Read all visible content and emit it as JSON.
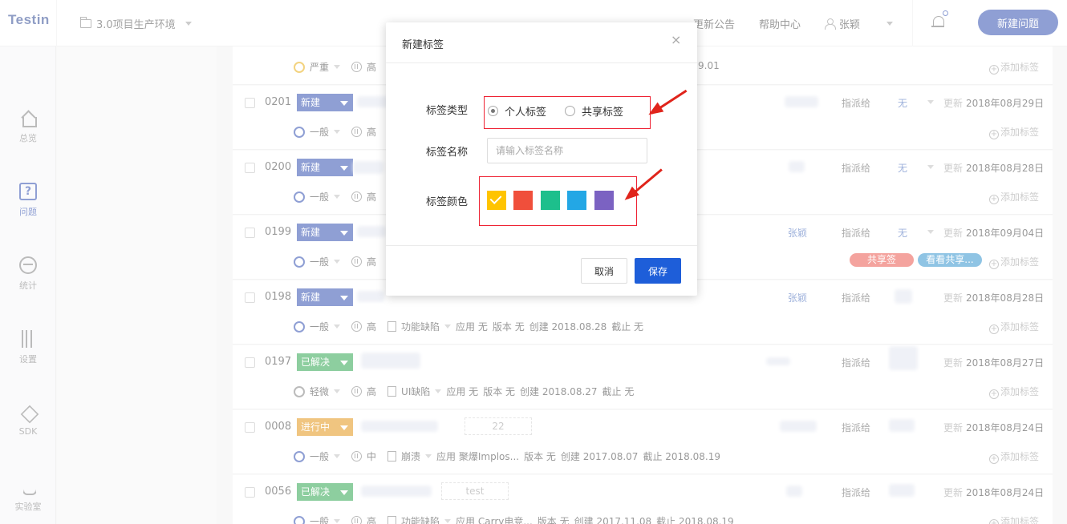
{
  "app": {
    "logo": "Testin",
    "project": "3.0项目生产环境",
    "links": {
      "announce": "更新公告",
      "help": "帮助中心"
    },
    "user": "张颖",
    "new_issue": "新建问题"
  },
  "sidebar": {
    "items": [
      {
        "name": "home",
        "label": "总览",
        "icon": "home-icon",
        "active": false
      },
      {
        "name": "issues",
        "label": "问题",
        "icon": "question-icon",
        "active": true
      },
      {
        "name": "stats",
        "label": "统计",
        "icon": "stats-icon",
        "active": false
      },
      {
        "name": "settings",
        "label": "设置",
        "icon": "sliders-icon",
        "active": false
      },
      {
        "name": "sdk",
        "label": "SDK",
        "icon": "layers-icon",
        "active": false
      },
      {
        "name": "lab",
        "label": "实验室",
        "icon": "flask-icon",
        "active": false
      }
    ]
  },
  "list": {
    "add_tag": "添加标签",
    "assign_label": "指派给",
    "update_label": "更新",
    "rows": [
      {
        "id": "",
        "status": "",
        "severity": "严重",
        "priority": "高",
        "date_tail": "9.01"
      },
      {
        "id": "0201",
        "status": "新建",
        "status_color": "#1e3fa8",
        "assignee": "",
        "assign": "无",
        "updated": "2018年08月29日",
        "severity": "一般",
        "priority": "高"
      },
      {
        "id": "0200",
        "status": "新建",
        "status_color": "#1e3fa8",
        "assignee": "",
        "assign": "无",
        "updated": "2018年08月28日",
        "severity": "一般",
        "priority": "高"
      },
      {
        "id": "0199",
        "status": "新建",
        "status_color": "#1e3fa8",
        "assignee": "张颖",
        "assign": "无",
        "updated": "2018年09月04日",
        "severity": "一般",
        "priority": "高",
        "tags": [
          "共享签",
          "看看共享..."
        ]
      },
      {
        "id": "0198",
        "status": "新建",
        "status_color": "#1e3fa8",
        "assignee": "张颖",
        "assign": "",
        "updated": "2018年08月28日",
        "severity": "一般",
        "priority": "高",
        "type": "功能缺陷",
        "app": "应用 无",
        "version": "版本 无",
        "created": "创建 2018.08.28",
        "deadline": "截止 无"
      },
      {
        "id": "0197",
        "status": "已解决",
        "status_color": "#1a9c3e",
        "assignee": "",
        "assign": "",
        "updated": "2018年08月27日",
        "severity": "轻微",
        "priority": "高",
        "type": "UI缺陷",
        "app": "应用 无",
        "version": "版本 无",
        "created": "创建 2018.08.27",
        "deadline": "截止 无"
      },
      {
        "id": "0008",
        "status": "进行中",
        "status_color": "#e08a00",
        "tagbox": "22",
        "assignee": "",
        "assign": "",
        "updated": "2018年08月24日",
        "severity": "一般",
        "priority": "中",
        "type": "崩溃",
        "app": "应用 聚爆Implos...",
        "version": "版本 无",
        "created": "创建 2017.08.07",
        "deadline": "截止 2018.08.19"
      },
      {
        "id": "0056",
        "status": "已解决",
        "status_color": "#1a9c3e",
        "tagbox": "test",
        "assignee": "",
        "assign": "",
        "updated": "2018年08月24日",
        "severity": "一般",
        "priority": "高",
        "type": "功能缺陷",
        "app": "应用 Carry电竞...",
        "version": "版本 无",
        "created": "创建 2017.11.08",
        "deadline": "截止 2018.08.19"
      }
    ]
  },
  "modal": {
    "title": "新建标签",
    "close": "×",
    "type_label": "标签类型",
    "type_options": [
      "个人标签",
      "共享标签"
    ],
    "type_selected": "个人标签",
    "name_label": "标签名称",
    "name_placeholder": "请输入标签名称",
    "name_value": "",
    "color_label": "标签颜色",
    "colors": [
      "#ffc400",
      "#f04f3b",
      "#1dbf8c",
      "#23a7e5",
      "#7b62c2"
    ],
    "color_selected": 0,
    "cancel": "取消",
    "save": "保存"
  }
}
